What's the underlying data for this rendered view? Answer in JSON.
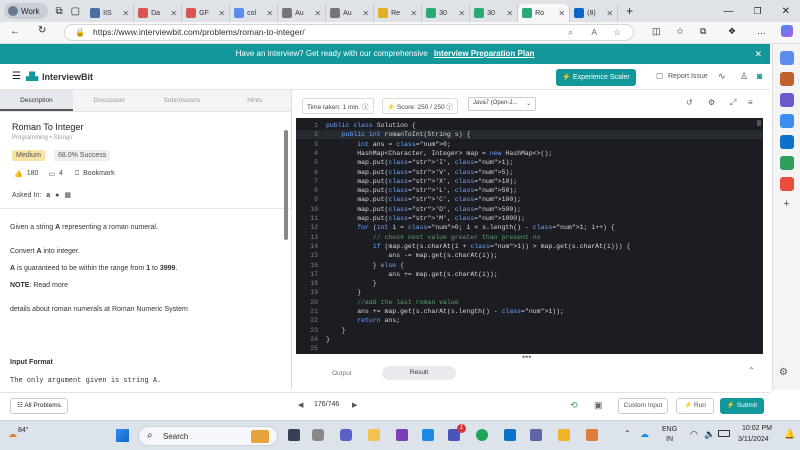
{
  "browser": {
    "profile": "Work",
    "tabs": [
      {
        "label": "IIS",
        "color": "#4a6fa5"
      },
      {
        "label": "Da",
        "color": "#d9534f"
      },
      {
        "label": "GF",
        "color": "#d9534f"
      },
      {
        "label": "col",
        "color": "#5b8def"
      },
      {
        "label": "Au",
        "color": "#777777"
      },
      {
        "label": "Au",
        "color": "#777777"
      },
      {
        "label": "Re",
        "color": "#e0b020"
      },
      {
        "label": "30",
        "color": "#2aa876"
      },
      {
        "label": "30",
        "color": "#2aa876"
      },
      {
        "label": "Ro",
        "color": "#2aa876",
        "active": true
      },
      {
        "label": "(8)",
        "color": "#0a66c2"
      }
    ],
    "url": "https://www.interviewbit.com/problems/roman-to-integer/"
  },
  "banner": {
    "text": "Have an interview? Get ready with our comprehensive",
    "link": "Interview Preparation Plan"
  },
  "header": {
    "logo": "InterviewBit",
    "experience_button": "Experience Scaler",
    "report_issue": "Report Issue"
  },
  "problem_tabs": [
    "Description",
    "Discussion",
    "Submissions",
    "Hints"
  ],
  "problem": {
    "title": "Roman To Integer",
    "category": "Programming • Strings",
    "difficulty": "Medium",
    "success": "68.0% Success",
    "likes": "180",
    "comments": "4",
    "bookmark": "Bookmark",
    "asked_in": "Asked In:",
    "desc1_pre": "Given a string ",
    "desc1_bold": "A",
    "desc1_post": " representing a roman numeral.",
    "desc2_pre": "Convert ",
    "desc2_bold": "A",
    "desc2_post": " into integer.",
    "desc3_pre": "",
    "desc3_bold": "A",
    "desc3_mid": " is guaranteed to be within the range from ",
    "desc3_b2": "1",
    "desc3_to": " to ",
    "desc3_b3": "3999",
    "desc3_post": ".",
    "note_bold": "NOTE",
    "note_text": ": Read more",
    "details": "details about roman numerals at Roman Numeric System",
    "input_format": "Input Format",
    "input_text": "The only argument given is string A."
  },
  "editor_toolbar": {
    "time": "Time taken: 1 min.",
    "score": "Score: 250 / 250",
    "language": "Java7 (Open-J..."
  },
  "code_lines": [
    "public class Solution {",
    "    public int romanToInt(String s) {",
    "        int ans = 0;",
    "        HashMap<Character, Integer> map = new HashMap<>();",
    "        map.put('I', 1);",
    "        map.put('V', 5);",
    "        map.put('X', 10);",
    "        map.put('L', 50);",
    "        map.put('C', 100);",
    "        map.put('D', 500);",
    "        map.put('M', 1000);",
    "        for (int i = 0; i < s.length() - 1; i++) {",
    "            // check next value greater than present no",
    "            if (map.get(s.charAt(i + 1)) > map.get(s.charAt(i))) {",
    "                ans -= map.get(s.charAt(i));",
    "            } else {",
    "                ans += map.get(s.charAt(i));",
    "            }",
    "        }",
    "        //add the last roman value",
    "        ans += map.get(s.charAt(s.length() - 1));",
    "        return ans;",
    "    }",
    "}",
    ""
  ],
  "output_tabs": [
    "Output",
    "Result"
  ],
  "footer": {
    "all_problems": "All Problems",
    "page": "176/746",
    "custom_input": "Custom Input",
    "run": "Run",
    "submit": "Submit"
  },
  "taskbar": {
    "weather": "84°",
    "search": "Search",
    "lang1": "ENG",
    "lang2": "IN",
    "time": "10:02 PM",
    "date": "3/11/2024",
    "badge": "1"
  },
  "colors": {
    "teal": "#12979b",
    "editor_bg": "#1b1d22"
  }
}
